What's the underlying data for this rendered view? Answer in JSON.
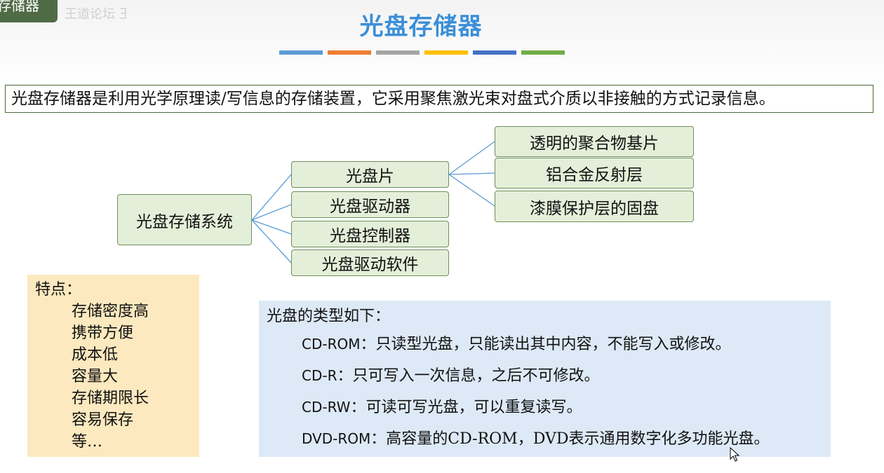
{
  "corner": {
    "tab_text": "存储器",
    "watermark": "王道论坛  王道计算机"
  },
  "title": "光盘存储器",
  "accent_colors": [
    "#5b9bd5",
    "#ed7d31",
    "#a5a5a5",
    "#ffc000",
    "#4472c4",
    "#70ad47"
  ],
  "definition": "光盘存储器是利用光学原理读/写信息的存储装置，它采用聚焦激光束对盘式介质以非接触的方式记录信息。",
  "tree": {
    "root": "光盘存储系统",
    "children": [
      "光盘片",
      "光盘驱动器",
      "光盘控制器",
      "光盘驱动软件"
    ],
    "disc_parts": [
      "透明的聚合物基片",
      "铝合金反射层",
      "漆膜保护层的固盘"
    ]
  },
  "features": {
    "title": "特点：",
    "items": [
      "存储密度高",
      "携带方便",
      "成本低",
      "容量大",
      "存储期限长",
      "容易保存",
      "等…"
    ]
  },
  "types": {
    "intro": "光盘的类型如下：",
    "list": [
      {
        "code": "CD-ROM",
        "desc": "：只读型光盘，只能读出其中内容，不能写入或修改。"
      },
      {
        "code": "CD-R",
        "desc": "：只可写入一次信息，之后不可修改。"
      },
      {
        "code": "CD-RW",
        "desc": "：可读可写光盘，可以重复读写。"
      },
      {
        "code": "DVD-ROM",
        "desc": "：高容量的CD-ROM，DVD表示通用数字化多功能光盘。"
      }
    ]
  },
  "colors": {
    "title": "#3b8ed8",
    "node_fill": "#e4efd9",
    "node_border": "#6d8f5c",
    "connector": "#5b9bd5",
    "features_bg": "#fde9bf",
    "types_bg": "#dde9f6"
  }
}
